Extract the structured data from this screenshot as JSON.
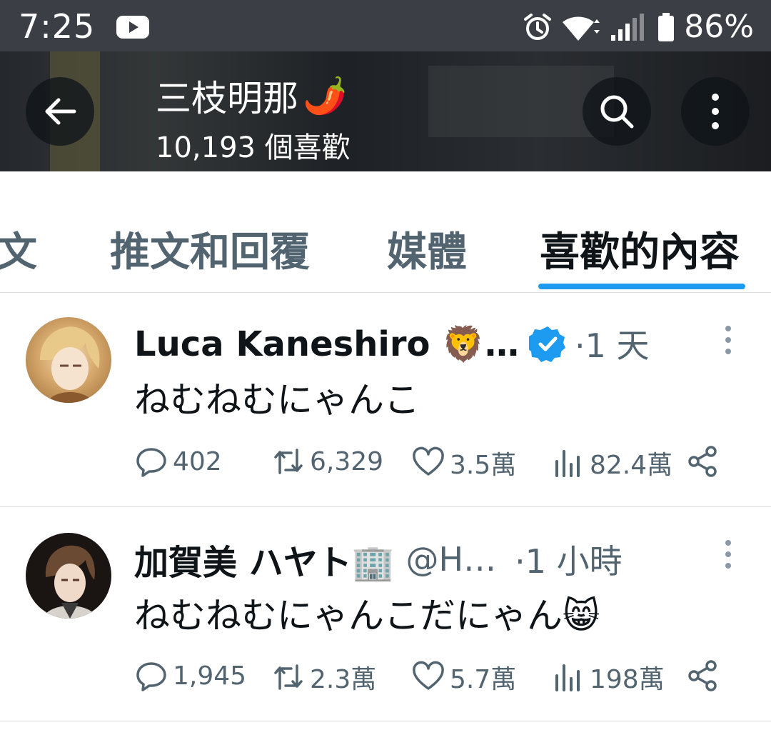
{
  "status_bar": {
    "time": "7:25",
    "battery_percent": "86%"
  },
  "header": {
    "profile_name": "三枝明那",
    "name_emoji": "🌶️",
    "likes_count": "10,193 個喜歡"
  },
  "tabs": [
    {
      "label": "文",
      "active": false
    },
    {
      "label": "推文和回覆",
      "active": false
    },
    {
      "label": "媒體",
      "active": false
    },
    {
      "label": "喜歡的內容",
      "active": true
    }
  ],
  "posts": [
    {
      "author": "Luca Kaneshiro 🦁…",
      "verified": true,
      "time": "·1 天",
      "text": "ねむねむにゃんこ",
      "stats": {
        "replies": "402",
        "retweets": "6,329",
        "likes": "3.5萬",
        "views": "82.4萬"
      }
    },
    {
      "author": "加賀美 ハヤト🏢",
      "handle": "@H…",
      "time": "·1 小時",
      "text": "ねむねむにゃんこだにゃん😸",
      "stats": {
        "replies": "1,945",
        "retweets": "2.3萬",
        "likes": "5.7萬",
        "views": "198萬"
      }
    }
  ],
  "colors": {
    "accent": "#1d9bf0",
    "verified": "#1d9bf0",
    "muted": "#536471",
    "text": "#0f1419"
  }
}
